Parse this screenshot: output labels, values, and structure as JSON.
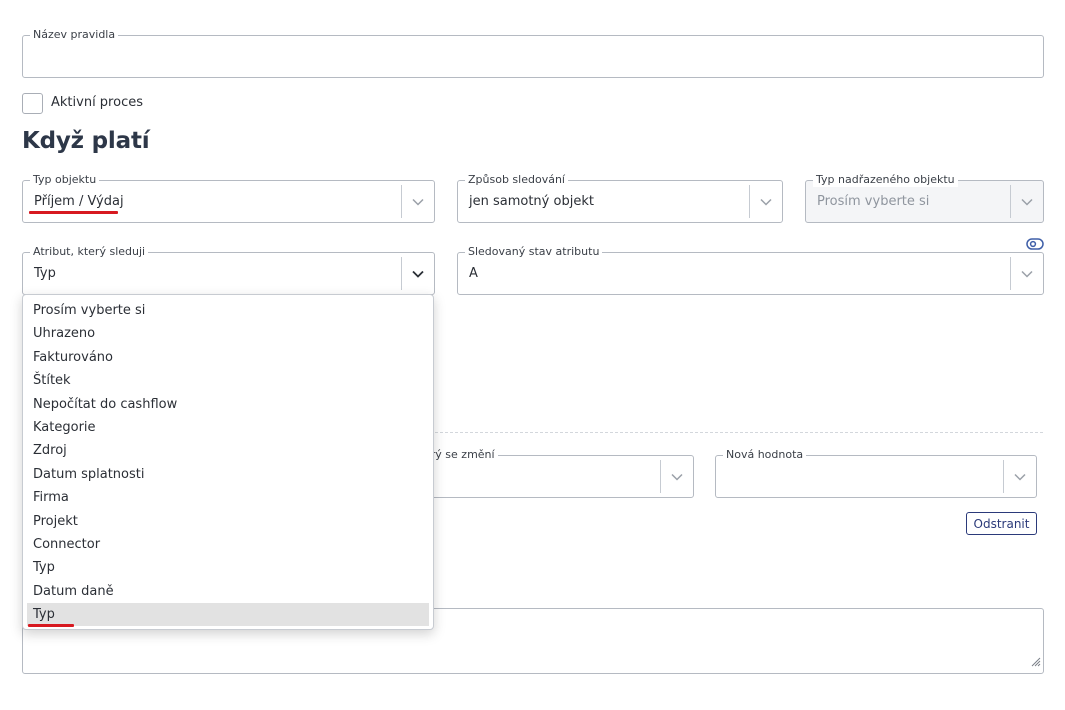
{
  "form": {
    "rule_name_label": "Název pravidla",
    "rule_name_value": "",
    "active_label": "Aktivní proces",
    "active_checked": false,
    "section_title": "Když platí"
  },
  "conditions": {
    "object_type": {
      "label": "Typ objektu",
      "value": "Příjem / Výdaj"
    },
    "tracking_mode": {
      "label": "Způsob sledování",
      "value": "jen samotný objekt"
    },
    "parent_type": {
      "label": "Typ nadřazeného objektu",
      "placeholder": "Prosím vyberte si"
    },
    "attribute": {
      "label": "Atribut, který sleduji",
      "value": "Typ"
    },
    "attribute_state": {
      "label": "Sledovaný stav atributu",
      "value": "A"
    }
  },
  "actions": {
    "changing_attr_label": "erý se změní",
    "new_value_label": "Nová hodnota",
    "remove_button": "Odstranit"
  },
  "dropdown": {
    "options": [
      "Prosím vyberte si",
      "Uhrazeno",
      "Fakturováno",
      "Štítek",
      "Nepočítat do cashflow",
      "Kategorie",
      "Zdroj",
      "Datum splatnosti",
      "Firma",
      "Projekt",
      "Connector",
      "Typ",
      "Datum daně",
      "Typ"
    ],
    "highlighted_index": 13
  },
  "colors": {
    "accent_red": "#d71920",
    "button_navy": "#2b3a7a",
    "border": "#b5bac2"
  }
}
